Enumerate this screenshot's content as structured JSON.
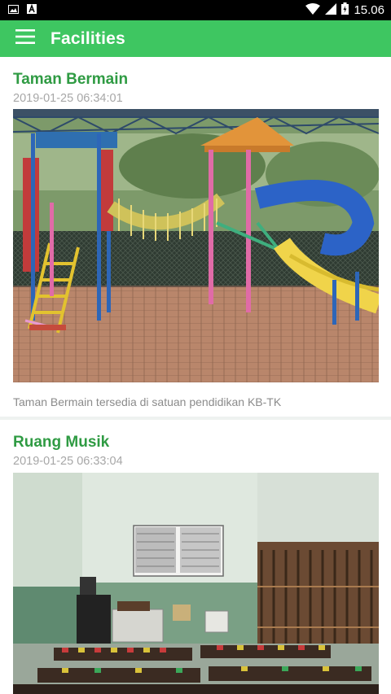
{
  "status_bar": {
    "time": "15.06",
    "left_icons": [
      "image-icon",
      "a-icon"
    ],
    "right_icons": [
      "wifi-icon",
      "signal-icon",
      "battery-icon"
    ]
  },
  "app_bar": {
    "title": "Facilities",
    "menu_icon": "hamburger-menu-icon",
    "color": "#3ec661"
  },
  "facilities": [
    {
      "title": "Taman Bermain",
      "date": "2019-01-25 06:34:01",
      "image": "playground-photo",
      "caption": "Taman Bermain tersedia di satuan pendidikan KB-TK"
    },
    {
      "title": "Ruang Musik",
      "date": "2019-01-25 06:33:04",
      "image": "music-room-photo",
      "caption": ""
    }
  ],
  "colors": {
    "title_green": "#2f9b43",
    "date_gray": "#a7a7a7"
  }
}
